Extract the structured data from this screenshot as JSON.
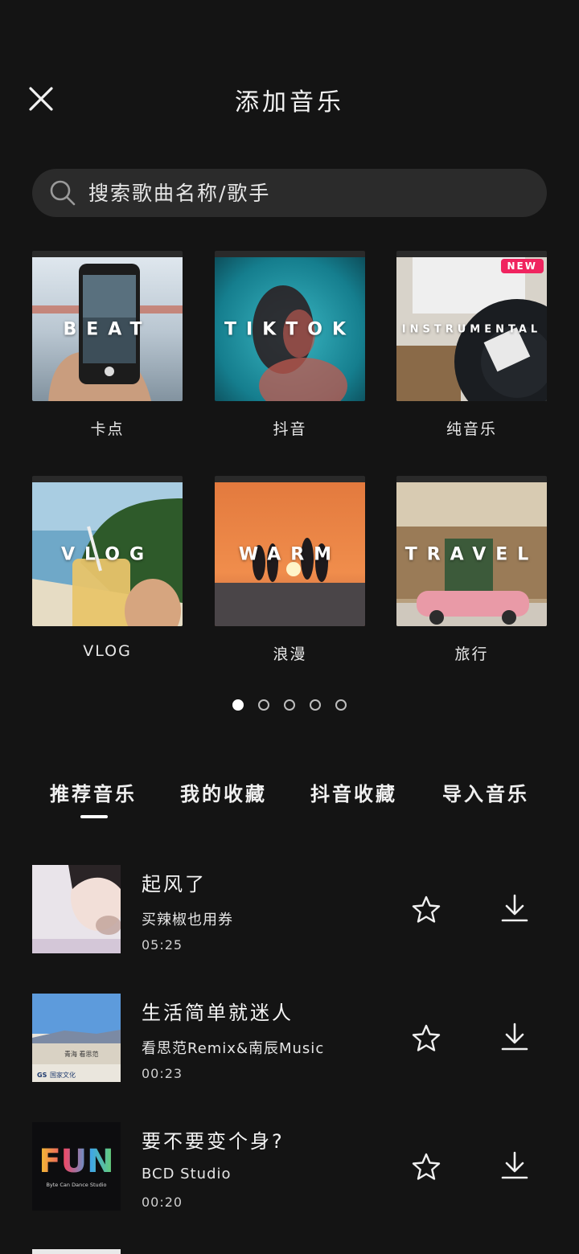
{
  "header": {
    "title": "添加音乐",
    "close_icon": "close-icon"
  },
  "search": {
    "placeholder": "搜索歌曲名称/歌手",
    "icon": "search-icon"
  },
  "categories": [
    {
      "label": "卡点",
      "cover_text": "BEAT",
      "badge": ""
    },
    {
      "label": "抖音",
      "cover_text": "TIKTOK",
      "badge": ""
    },
    {
      "label": "纯音乐",
      "cover_text": "INSTRUMENTAL",
      "badge": "NEW"
    },
    {
      "label": "VLOG",
      "cover_text": "VLOG",
      "badge": ""
    },
    {
      "label": "浪漫",
      "cover_text": "WARM",
      "badge": ""
    },
    {
      "label": "旅行",
      "cover_text": "TRAVEL",
      "badge": ""
    }
  ],
  "pagination": {
    "pages": 5,
    "active": 1
  },
  "tabs": [
    "推荐音乐",
    "我的收藏",
    "抖音收藏",
    "导入音乐"
  ],
  "active_tab": 0,
  "songs": [
    {
      "name": "起风了",
      "artist": "买辣椒也用券",
      "duration": "05:25"
    },
    {
      "name": "生活简单就迷人",
      "artist": "看思范Remix&南辰Music",
      "duration": "00:23"
    },
    {
      "name": "要不要变个身?",
      "artist": "BCD Studio",
      "duration": "00:20"
    }
  ],
  "thumb_texts": {
    "song2_caption": "青海 看思范",
    "song2_brand": "国家文化",
    "song3_logo": "FUN",
    "song3_sub": "Byte Can Dance Studio"
  },
  "colors": {
    "background": "#141414",
    "search_bg": "#2b2b2b",
    "badge": "#f0245f"
  }
}
